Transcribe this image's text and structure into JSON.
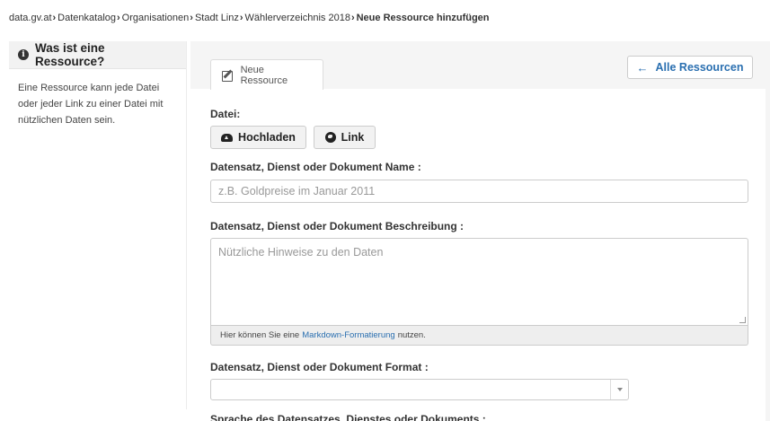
{
  "breadcrumb": [
    {
      "label": "data.gv.at"
    },
    {
      "label": "Datenkatalog"
    },
    {
      "label": "Organisationen"
    },
    {
      "label": "Stadt Linz"
    },
    {
      "label": "Wählerverzeichnis 2018"
    },
    {
      "label": "Neue Ressource hinzufügen"
    }
  ],
  "sidebar": {
    "title": "Was ist eine Ressource?",
    "body_lines": [
      "Eine Ressource kann jede Datei",
      "oder jeder Link zu einer Datei mit",
      "nützlichen Daten sein."
    ]
  },
  "tabs": [
    {
      "label": "Neue Ressource",
      "icon": "edit-icon"
    }
  ],
  "toolbar": {
    "all_resources_label": "Alle Ressourcen",
    "icon": "arrow-left-icon"
  },
  "form": {
    "file_label": "Datei:",
    "upload_label": "Hochladen",
    "link_label": "Link",
    "name_label": "Datensatz, Dienst oder Dokument Name :",
    "name_placeholder": "z.B. Goldpreise im Januar 2011",
    "description_label": "Datensatz, Dienst oder Dokument Beschreibung :",
    "description_placeholder": "Nützliche Hinweise zu den Daten",
    "hint_before": "Hier können Sie eine",
    "hint_link": "Markdown-Formatierung",
    "hint_after": "nutzen.",
    "format_label": "Datensatz, Dienst oder Dokument Format :",
    "format_value": "",
    "language_label": "Sprache des Datensatzes, Dienstes oder Dokuments :"
  },
  "colors": {
    "accent": "#2a6fb0",
    "panel_bg": "#f5f5f5"
  }
}
